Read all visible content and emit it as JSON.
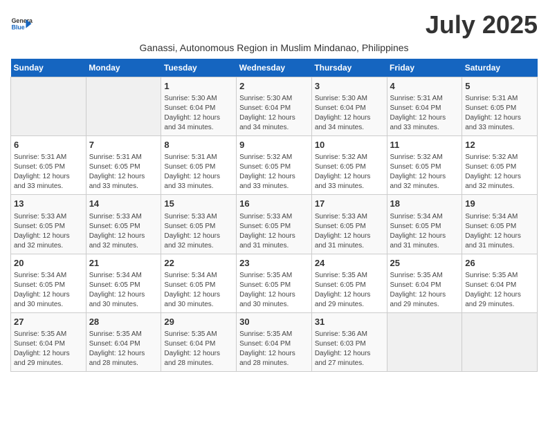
{
  "header": {
    "logo_line1": "General",
    "logo_line2": "Blue",
    "title": "July 2025",
    "subtitle": "Ganassi, Autonomous Region in Muslim Mindanao, Philippines"
  },
  "days_of_week": [
    "Sunday",
    "Monday",
    "Tuesday",
    "Wednesday",
    "Thursday",
    "Friday",
    "Saturday"
  ],
  "weeks": [
    [
      {
        "day": "",
        "info": ""
      },
      {
        "day": "",
        "info": ""
      },
      {
        "day": "1",
        "info": "Sunrise: 5:30 AM\nSunset: 6:04 PM\nDaylight: 12 hours and 34 minutes."
      },
      {
        "day": "2",
        "info": "Sunrise: 5:30 AM\nSunset: 6:04 PM\nDaylight: 12 hours and 34 minutes."
      },
      {
        "day": "3",
        "info": "Sunrise: 5:30 AM\nSunset: 6:04 PM\nDaylight: 12 hours and 34 minutes."
      },
      {
        "day": "4",
        "info": "Sunrise: 5:31 AM\nSunset: 6:04 PM\nDaylight: 12 hours and 33 minutes."
      },
      {
        "day": "5",
        "info": "Sunrise: 5:31 AM\nSunset: 6:05 PM\nDaylight: 12 hours and 33 minutes."
      }
    ],
    [
      {
        "day": "6",
        "info": "Sunrise: 5:31 AM\nSunset: 6:05 PM\nDaylight: 12 hours and 33 minutes."
      },
      {
        "day": "7",
        "info": "Sunrise: 5:31 AM\nSunset: 6:05 PM\nDaylight: 12 hours and 33 minutes."
      },
      {
        "day": "8",
        "info": "Sunrise: 5:31 AM\nSunset: 6:05 PM\nDaylight: 12 hours and 33 minutes."
      },
      {
        "day": "9",
        "info": "Sunrise: 5:32 AM\nSunset: 6:05 PM\nDaylight: 12 hours and 33 minutes."
      },
      {
        "day": "10",
        "info": "Sunrise: 5:32 AM\nSunset: 6:05 PM\nDaylight: 12 hours and 33 minutes."
      },
      {
        "day": "11",
        "info": "Sunrise: 5:32 AM\nSunset: 6:05 PM\nDaylight: 12 hours and 32 minutes."
      },
      {
        "day": "12",
        "info": "Sunrise: 5:32 AM\nSunset: 6:05 PM\nDaylight: 12 hours and 32 minutes."
      }
    ],
    [
      {
        "day": "13",
        "info": "Sunrise: 5:33 AM\nSunset: 6:05 PM\nDaylight: 12 hours and 32 minutes."
      },
      {
        "day": "14",
        "info": "Sunrise: 5:33 AM\nSunset: 6:05 PM\nDaylight: 12 hours and 32 minutes."
      },
      {
        "day": "15",
        "info": "Sunrise: 5:33 AM\nSunset: 6:05 PM\nDaylight: 12 hours and 32 minutes."
      },
      {
        "day": "16",
        "info": "Sunrise: 5:33 AM\nSunset: 6:05 PM\nDaylight: 12 hours and 31 minutes."
      },
      {
        "day": "17",
        "info": "Sunrise: 5:33 AM\nSunset: 6:05 PM\nDaylight: 12 hours and 31 minutes."
      },
      {
        "day": "18",
        "info": "Sunrise: 5:34 AM\nSunset: 6:05 PM\nDaylight: 12 hours and 31 minutes."
      },
      {
        "day": "19",
        "info": "Sunrise: 5:34 AM\nSunset: 6:05 PM\nDaylight: 12 hours and 31 minutes."
      }
    ],
    [
      {
        "day": "20",
        "info": "Sunrise: 5:34 AM\nSunset: 6:05 PM\nDaylight: 12 hours and 30 minutes."
      },
      {
        "day": "21",
        "info": "Sunrise: 5:34 AM\nSunset: 6:05 PM\nDaylight: 12 hours and 30 minutes."
      },
      {
        "day": "22",
        "info": "Sunrise: 5:34 AM\nSunset: 6:05 PM\nDaylight: 12 hours and 30 minutes."
      },
      {
        "day": "23",
        "info": "Sunrise: 5:35 AM\nSunset: 6:05 PM\nDaylight: 12 hours and 30 minutes."
      },
      {
        "day": "24",
        "info": "Sunrise: 5:35 AM\nSunset: 6:05 PM\nDaylight: 12 hours and 29 minutes."
      },
      {
        "day": "25",
        "info": "Sunrise: 5:35 AM\nSunset: 6:04 PM\nDaylight: 12 hours and 29 minutes."
      },
      {
        "day": "26",
        "info": "Sunrise: 5:35 AM\nSunset: 6:04 PM\nDaylight: 12 hours and 29 minutes."
      }
    ],
    [
      {
        "day": "27",
        "info": "Sunrise: 5:35 AM\nSunset: 6:04 PM\nDaylight: 12 hours and 29 minutes."
      },
      {
        "day": "28",
        "info": "Sunrise: 5:35 AM\nSunset: 6:04 PM\nDaylight: 12 hours and 28 minutes."
      },
      {
        "day": "29",
        "info": "Sunrise: 5:35 AM\nSunset: 6:04 PM\nDaylight: 12 hours and 28 minutes."
      },
      {
        "day": "30",
        "info": "Sunrise: 5:35 AM\nSunset: 6:04 PM\nDaylight: 12 hours and 28 minutes."
      },
      {
        "day": "31",
        "info": "Sunrise: 5:36 AM\nSunset: 6:03 PM\nDaylight: 12 hours and 27 minutes."
      },
      {
        "day": "",
        "info": ""
      },
      {
        "day": "",
        "info": ""
      }
    ]
  ]
}
